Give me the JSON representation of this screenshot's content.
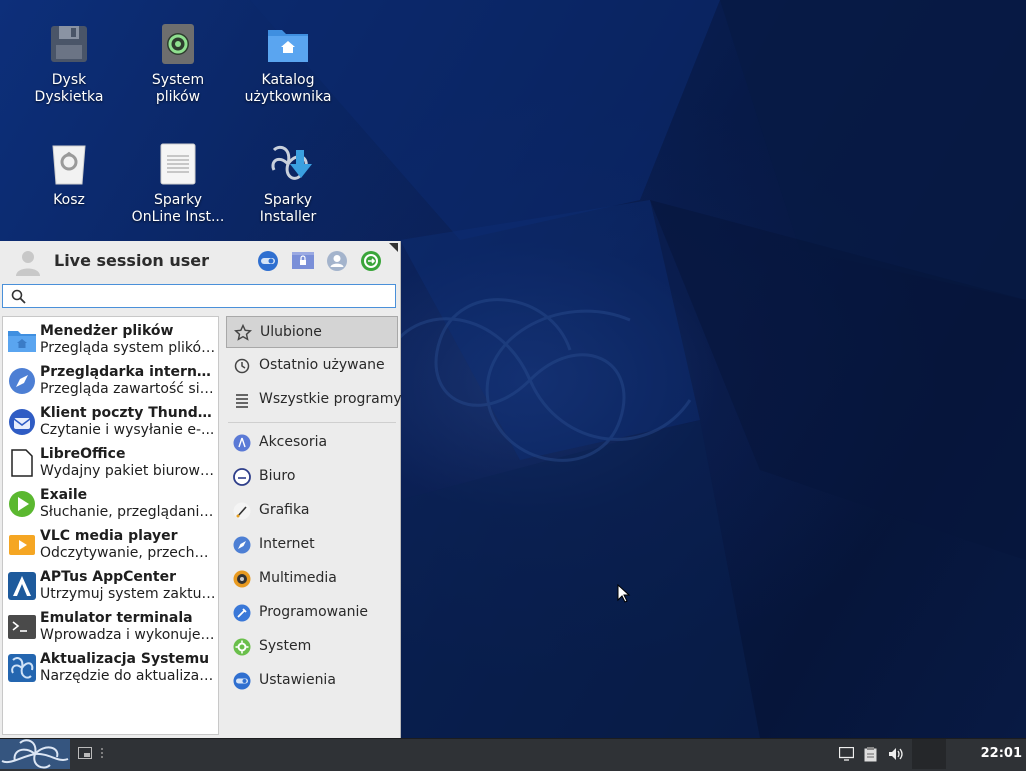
{
  "desktop": {
    "icons": [
      {
        "label_line1": "Dysk",
        "label_line2": "Dyskietka",
        "icon": "floppy-disk-icon"
      },
      {
        "label_line1": "System",
        "label_line2": "plików",
        "icon": "filesystem-icon"
      },
      {
        "label_line1": "Katalog",
        "label_line2": "użytkownika",
        "icon": "home-folder-icon"
      },
      {
        "label_line1": "Kosz",
        "label_line2": "",
        "icon": "trash-icon"
      },
      {
        "label_line1": "Sparky",
        "label_line2": "OnLine Inst...",
        "icon": "document-icon"
      },
      {
        "label_line1": "Sparky",
        "label_line2": "Installer",
        "icon": "installer-icon"
      }
    ]
  },
  "menu": {
    "user_name": "Live session user",
    "search": {
      "value": "",
      "placeholder": ""
    },
    "favorites": [
      {
        "title": "Menedżer plików",
        "desc": "Przegląda system plików...",
        "icon": "file-manager-icon"
      },
      {
        "title": "Przeglądarka interne...",
        "desc": "Przegląda zawartość siec...",
        "icon": "web-browser-icon"
      },
      {
        "title": "Klient poczty Thunde...",
        "desc": "Czytanie i wysyłanie e-...",
        "icon": "thunderbird-icon"
      },
      {
        "title": "LibreOffice",
        "desc": "Wydajny pakiet biurowy,...",
        "icon": "libreoffice-icon"
      },
      {
        "title": "Exaile",
        "desc": "Słuchanie, przeglądanie i...",
        "icon": "exaile-icon"
      },
      {
        "title": "VLC media player",
        "desc": "Odczytywanie, przechwy...",
        "icon": "vlc-icon"
      },
      {
        "title": "APTus AppCenter",
        "desc": "Utrzymuj system zaktual...",
        "icon": "aptus-icon"
      },
      {
        "title": "Emulator terminala",
        "desc": "Wprowadza i wykonuje ...",
        "icon": "terminal-icon"
      },
      {
        "title": "Aktualizacja Systemu",
        "desc": "Narzędzie do aktualizacji...",
        "icon": "system-update-icon"
      }
    ],
    "categories": [
      {
        "label": "Ulubione",
        "icon": "star-icon"
      },
      {
        "label": "Ostatnio używane",
        "icon": "clock-icon"
      },
      {
        "label": "Wszystkie programy",
        "icon": "list-icon"
      },
      {
        "label": "Akcesoria",
        "icon": "accessories-icon"
      },
      {
        "label": "Biuro",
        "icon": "office-icon"
      },
      {
        "label": "Grafika",
        "icon": "graphics-icon"
      },
      {
        "label": "Internet",
        "icon": "internet-icon"
      },
      {
        "label": "Multimedia",
        "icon": "multimedia-icon"
      },
      {
        "label": "Programowanie",
        "icon": "programming-icon"
      },
      {
        "label": "System",
        "icon": "system-icon"
      },
      {
        "label": "Ustawienia",
        "icon": "settings-icon"
      }
    ]
  },
  "taskbar": {
    "clock": "22:01"
  },
  "colors": {
    "accent": "#4a90d9",
    "menu_bg": "#ececec",
    "taskbar_bg": "#2f3236"
  }
}
